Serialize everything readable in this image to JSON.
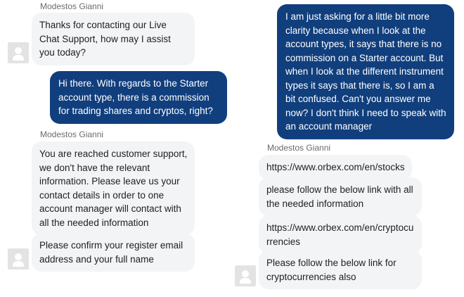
{
  "agent_name": "Modestos Gianni",
  "left_column": {
    "group1": {
      "sender": "Modestos Gianni",
      "messages": [
        "Thanks for contacting our Live Chat Support, how may I assist you today?"
      ]
    },
    "user_message": "Hi there. With regards to the Starter account type, there is a commission for trading shares and cryptos, right?",
    "group2": {
      "sender": "Modestos Gianni",
      "messages": [
        "You are reached customer support, we don't have the relevant information. Please leave us your contact details in order to one account manager will contact with all the needed information",
        "Please confirm your register email address and your full name"
      ]
    }
  },
  "right_column": {
    "user_message": "I am just asking for a little bit more clarity because when I look at the account types, it says that there is no commission on a Starter account. But when I look at the different instrument types it says that there is, so I am a bit confused. Can't you answer me now? I don't think I need to speak with an account manager",
    "group": {
      "sender": "Modestos Gianni",
      "messages": [
        "https://www.orbex.com/en/stocks",
        "please follow the below link with all the needed information",
        "https://www.orbex.com/en/cryptocurrencies",
        "Please follow the below link for cryptocurrencies also"
      ]
    }
  },
  "icons": {
    "avatar": "user-avatar-icon"
  },
  "colors": {
    "agent_bubble": "#f3f4f6",
    "user_bubble": "#113f7d",
    "user_text": "#ffffff",
    "agent_text": "#1f1f1f",
    "sender_name": "#6b6b6b"
  }
}
